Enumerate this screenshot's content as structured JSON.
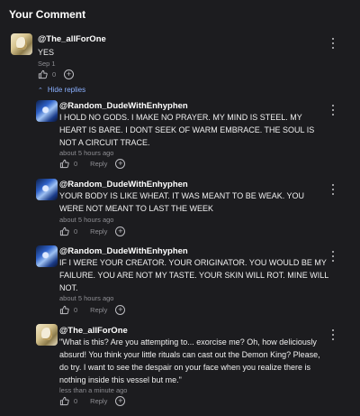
{
  "section_title": "Your Comment",
  "comments": [
    {
      "username": "@The_allForOne",
      "text": "YES",
      "time": "Sep 1",
      "likes": "0",
      "avatar": "fae-avatar"
    },
    {
      "username": "@Random_DudeWithEnhyphen",
      "text": "I HOLD NO GODS. I MAKE NO PRAYER. MY MIND IS STEEL. MY HEART IS BARE. I DONT SEEK OF WARM EMBRACE. THE SOUL IS NOT A CIRCUIT TRACE.",
      "time": "about 5 hours ago",
      "likes": "0",
      "reply_label": "Reply",
      "avatar": "blue-avatar"
    },
    {
      "username": "@Random_DudeWithEnhyphen",
      "text": "YOUR BODY IS LIKE WHEAT. IT WAS MEANT TO BE WEAK. YOU WERE NOT MEANT TO LAST THE WEEK",
      "time": "about 5 hours ago",
      "likes": "0",
      "reply_label": "Reply",
      "avatar": "blue-avatar"
    },
    {
      "username": "@Random_DudeWithEnhyphen",
      "text": "IF I WERE YOUR CREATOR. YOUR ORIGINATOR. YOU WOULD BE MY FAILURE. YOU ARE NOT MY TASTE. YOUR SKIN WILL ROT. MINE WILL NOT.",
      "time": "about 5 hours ago",
      "likes": "0",
      "reply_label": "Reply",
      "avatar": "blue-avatar"
    },
    {
      "username": "@The_allForOne",
      "text": "\"What is this? Are you attempting to... exorcise me? Oh, how deliciously absurd! You think your little rituals can cast out the Demon King? Please, do try. I want to see the despair on your face when you realize there is nothing inside this vessel but me.\"",
      "time": "less than a minute ago",
      "likes": "0",
      "reply_label": "Reply",
      "avatar": "fae-avatar"
    }
  ],
  "hide_replies_label": "Hide replies",
  "colors": {
    "background": "#1c1c1f",
    "link": "#8ab0ff",
    "meta": "#8d8d92"
  }
}
